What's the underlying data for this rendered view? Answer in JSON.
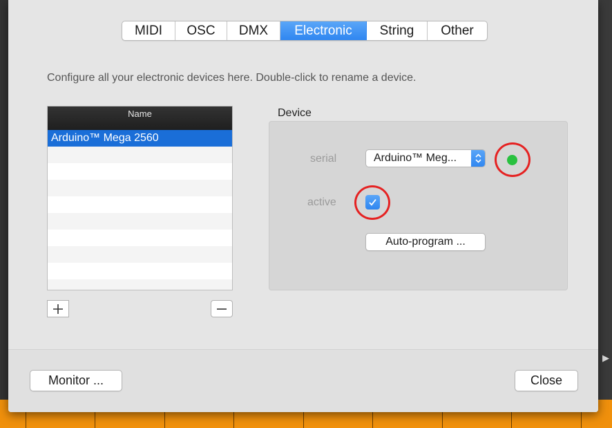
{
  "tabs": [
    {
      "label": "MIDI",
      "selected": false
    },
    {
      "label": "OSC",
      "selected": false
    },
    {
      "label": "DMX",
      "selected": false
    },
    {
      "label": "Electronic",
      "selected": true
    },
    {
      "label": "String",
      "selected": false
    },
    {
      "label": "Other",
      "selected": false
    }
  ],
  "description": "Configure all your electronic devices here. Double-click to rename a device.",
  "device_list": {
    "header": "Name",
    "items": [
      "Arduino™ Mega 2560"
    ],
    "selected_index": 0
  },
  "device_panel": {
    "title": "Device",
    "serial_label": "serial",
    "serial_value": "Arduino™ Meg...",
    "active_label": "active",
    "active_checked": true,
    "auto_program_label": "Auto-program ...",
    "status_color": "#29c13f"
  },
  "footer": {
    "monitor_label": "Monitor ...",
    "close_label": "Close"
  },
  "colors": {
    "accent": "#2f86f0",
    "selection": "#1a6ed8",
    "highlight_ring": "#e52222",
    "timeline": "#f0900c"
  }
}
